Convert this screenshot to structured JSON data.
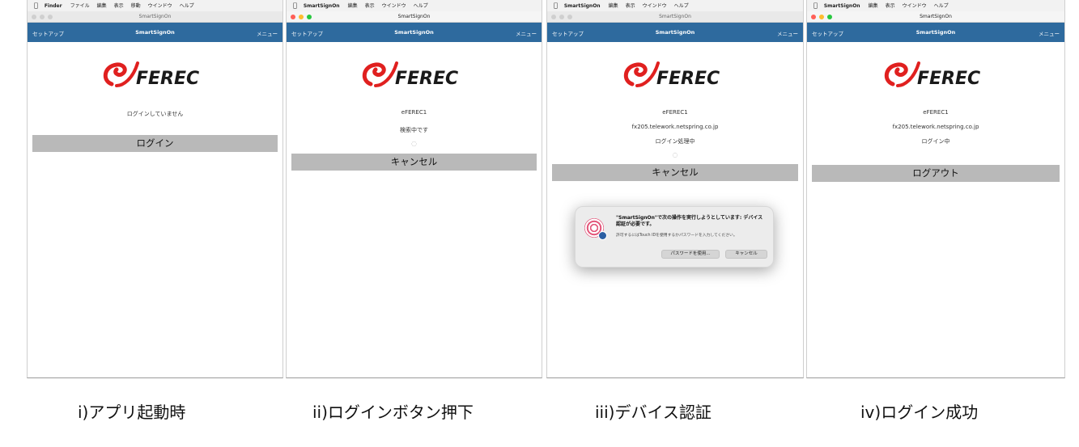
{
  "colors": {
    "navbar": "#2e6a9e",
    "button": "#b9b9b9",
    "logo_red": "#e0201f",
    "brand_text": "#1a1a1a"
  },
  "logo_text": "FEREC",
  "panels": [
    {
      "menubar": {
        "app": "Finder",
        "items": [
          "ファイル",
          "編集",
          "表示",
          "移動",
          "ウインドウ",
          "ヘルプ"
        ]
      },
      "window_title": "SmartSignOn",
      "nav": {
        "left": "セットアップ",
        "title": "SmartSignOn",
        "right": "メニュー"
      },
      "lines": [
        "ログインしていません"
      ],
      "button": "ログイン"
    },
    {
      "menubar": {
        "app": "SmartSignOn",
        "items": [
          "編集",
          "表示",
          "ウインドウ",
          "ヘルプ"
        ]
      },
      "window_title": "SmartSignOn",
      "nav": {
        "left": "セットアップ",
        "title": "SmartSignOn",
        "right": "メニュー"
      },
      "lines": [
        "eFEREC1",
        "検索中です"
      ],
      "button": "キャンセル"
    },
    {
      "menubar": {
        "app": "SmartSignOn",
        "items": [
          "編集",
          "表示",
          "ウインドウ",
          "ヘルプ"
        ]
      },
      "window_title": "SmartSignOn",
      "nav": {
        "left": "セットアップ",
        "title": "SmartSignOn",
        "right": "メニュー"
      },
      "lines": [
        "eFEREC1",
        "fx205.telework.netspring.co.jp",
        "ログイン処理中"
      ],
      "button": "キャンセル",
      "dialog": {
        "title": "\"SmartSignOn\"で次の操作を実行しようとしています: デバイス認証が必要です。",
        "body": "許可するにはTouch IDを使用するかパスワードを入力してください。",
        "password_button": "パスワードを使用...",
        "cancel_button": "キャンセル"
      }
    },
    {
      "menubar": {
        "app": "SmartSignOn",
        "items": [
          "編集",
          "表示",
          "ウインドウ",
          "ヘルプ"
        ]
      },
      "window_title": "SmartSignOn",
      "nav": {
        "left": "セットアップ",
        "title": "SmartSignOn",
        "right": "メニュー"
      },
      "lines": [
        "eFEREC1",
        "fx205.telework.netspring.co.jp",
        "ログイン中"
      ],
      "button": "ログアウト"
    }
  ],
  "captions": [
    "i)アプリ起動時",
    "ii)ログインボタン押下",
    "iii)デバイス認証",
    "iv)ログイン成功"
  ]
}
